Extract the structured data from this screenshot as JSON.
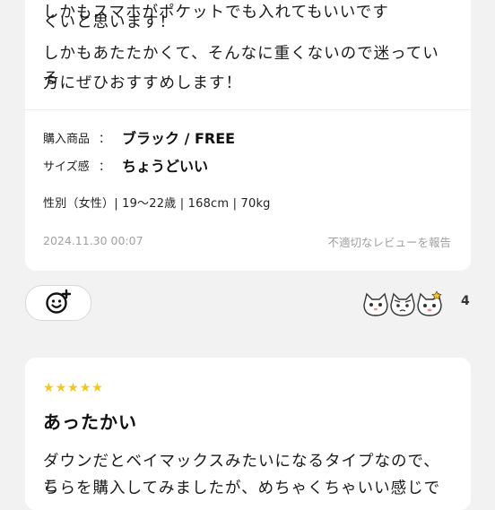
{
  "review1": {
    "body_lines": [
      "しかもスマホがポケットでも入れてもいいです",
      "くいと思います！",
      "しかもあたたかくて、そんなに重くないので迷っている",
      "方にぜひおすすめします！"
    ],
    "specs": [
      {
        "label": "購入商品",
        "colon": "：",
        "value": "ブラック / FREE"
      },
      {
        "label": "サイズ感",
        "colon": "：",
        "value": "ちょうどいい"
      }
    ],
    "profile": "性別（女性）| 19～22歳 | 168cm | 70kg",
    "date": "2024.11.30 00:07",
    "report_link": "不適切なレビューを報告"
  },
  "reactions": {
    "add_icon": "smiley-add-icon",
    "stickers": [
      "cat-sticker-icon",
      "cat-sticker-icon",
      "cat-sticker-icon"
    ],
    "count": "4"
  },
  "review2": {
    "rating": 5,
    "title": "あったかい",
    "body_lines": [
      "ダウンだとベイマックスみたいになるタイプなので、こ",
      "ちらを購入してみましたが、めちゃくちゃいい感じで"
    ]
  },
  "colors": {
    "background": "#f2f2f2",
    "card": "#ffffff",
    "star": "#f5c518",
    "muted_text": "#a0a0a0"
  }
}
